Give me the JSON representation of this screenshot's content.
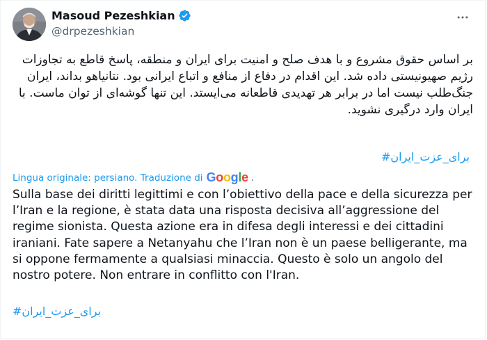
{
  "author": {
    "display_name": "Masoud Pezeshkian",
    "handle": "@drpezeshkian",
    "verified": true,
    "avatar_icon": "user-photo"
  },
  "tweet": {
    "original_text": "بر اساس حقوق مشروع و با هدف صلح و امنیت برای ایران و منطقه، پاسخ قاطع به تجاوزات رژیم صهیونیستی داده شد. این اقدام در دفاع از منافع و اتباع ایرانی بود. نتانیاهو بداند، ایران جنگ‌طلب نیست اما در برابر هر تهدیدی قاطعانه می‌ایستد. این تنها گوشه‌ای از توان ماست. با ایران وارد درگیری نشوید.",
    "hashtag_original": "#برای_عزت_ایران",
    "translation_note": "Lingua originale: persiano. Traduzione di",
    "translation_provider": [
      "G",
      "o",
      "o",
      "g",
      "l",
      "e"
    ],
    "translation_suffix": ".",
    "translated_text": "Sulla base dei diritti legittimi e con l’obiettivo della pace e della sicurezza per l’Iran e la regione, è stata data una risposta decisiva all’aggressione del regime sionista. Questa azione era in difesa degli interessi e dei cittadini iraniani. Fate sapere a Netanyahu che l’Iran non è un paese belligerante, ma si oppone fermamente a qualsiasi minaccia. Questo è solo un angolo del nostro potere. Non entrare in conflitto con l'Iran.",
    "hashtag_translated": "#برای_عزت_ایران"
  },
  "colors": {
    "link": "#1d9bf0",
    "text": "#0f1419",
    "secondary": "#536471",
    "verified": "#1d9bf0",
    "google": [
      "#4285F4",
      "#EA4335",
      "#FBBC05",
      "#4285F4",
      "#34A853",
      "#EA4335"
    ]
  },
  "icons": {
    "verified": "verified-badge-icon",
    "more": "more-options-icon"
  }
}
